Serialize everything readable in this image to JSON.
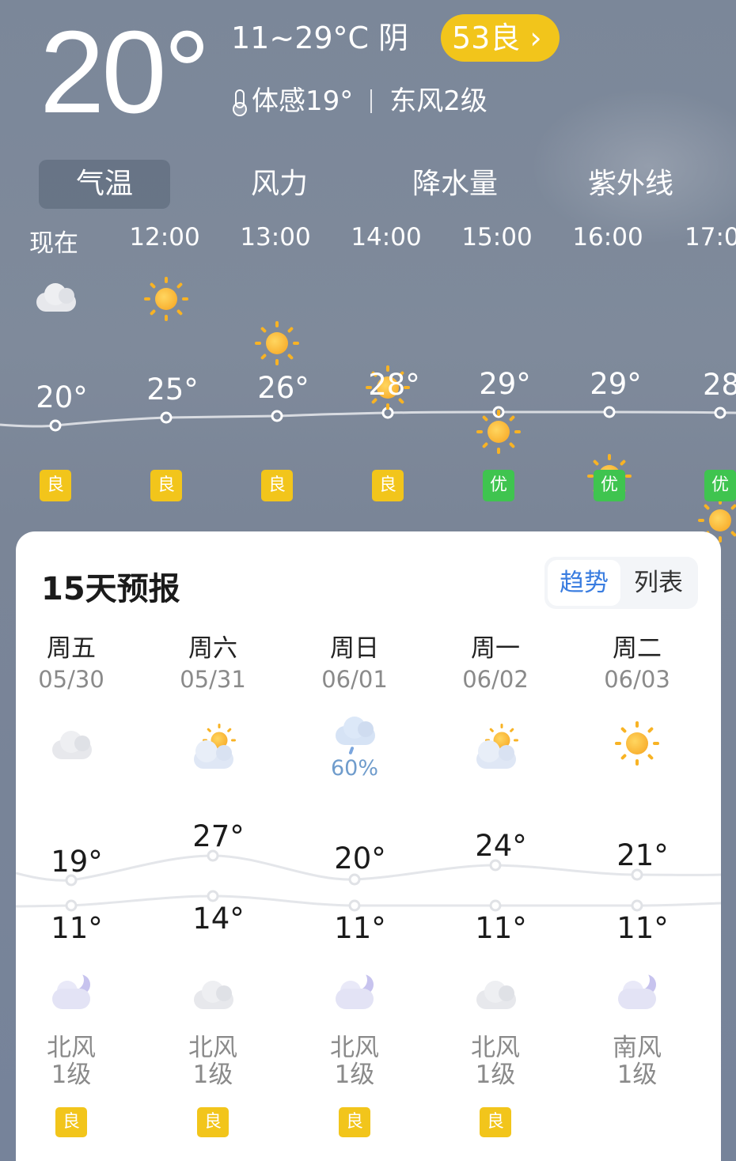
{
  "current": {
    "temp": "20°",
    "range_condition": "11~29°C 阴",
    "aqi": "53良 ›",
    "feels_like": "体感19°",
    "wind": "东风2级"
  },
  "tabs": [
    "气温",
    "风力",
    "降水量",
    "紫外线"
  ],
  "hourly": [
    {
      "time": "现在",
      "icon": "cloud-icon",
      "temp": "20°",
      "aqi": "良"
    },
    {
      "time": "12:00",
      "icon": "sun-icon",
      "temp": "25°",
      "aqi": "良"
    },
    {
      "time": "13:00",
      "icon": "sun-icon",
      "temp": "26°",
      "aqi": "良"
    },
    {
      "time": "14:00",
      "icon": "sun-icon",
      "temp": "28°",
      "aqi": "良"
    },
    {
      "time": "15:00",
      "icon": "sun-icon",
      "temp": "29°",
      "aqi": "优"
    },
    {
      "time": "16:00",
      "icon": "sun-icon",
      "temp": "29°",
      "aqi": "优"
    },
    {
      "time": "17:0",
      "icon": "sun-icon",
      "temp": "28",
      "aqi": "优"
    }
  ],
  "forecast": {
    "title": "15天预报",
    "toggle": {
      "trend": "趋势",
      "list": "列表"
    },
    "days": [
      {
        "name": "周五",
        "date": "05/30",
        "icon": "cloud-icon",
        "precip": "",
        "high": "19°",
        "low": "11°",
        "night_icon": "moon-cloud-icon",
        "wind_dir": "北风",
        "wind_level": "1级",
        "aqi": "良"
      },
      {
        "name": "周六",
        "date": "05/31",
        "icon": "sun-cloud-icon",
        "precip": "",
        "high": "27°",
        "low": "14°",
        "night_icon": "cloud-icon",
        "wind_dir": "北风",
        "wind_level": "1级",
        "aqi": "良"
      },
      {
        "name": "周日",
        "date": "06/01",
        "icon": "rain-icon",
        "precip": "60%",
        "high": "20°",
        "low": "11°",
        "night_icon": "moon-cloud-icon",
        "wind_dir": "北风",
        "wind_level": "1级",
        "aqi": "良"
      },
      {
        "name": "周一",
        "date": "06/02",
        "icon": "sun-cloud-icon",
        "precip": "",
        "high": "24°",
        "low": "11°",
        "night_icon": "cloud-icon",
        "wind_dir": "北风",
        "wind_level": "1级",
        "aqi": "良"
      },
      {
        "name": "周二",
        "date": "06/03",
        "icon": "sun-icon",
        "precip": "",
        "high": "21°",
        "low": "11°",
        "night_icon": "moon-cloud-icon",
        "wind_dir": "南风",
        "wind_level": "1级",
        "aqi": ""
      }
    ]
  },
  "colors": {
    "aqi_good": "#3fc44f",
    "aqi_moderate": "#f2c51b",
    "toggle_active": "#3a7de0"
  }
}
